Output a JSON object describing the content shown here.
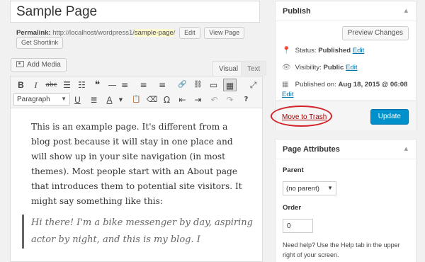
{
  "title": {
    "value": "Sample Page"
  },
  "permalink": {
    "label": "Permalink:",
    "base_url": "http://localhost/wordpress1/",
    "slug": "sample-page",
    "trailing": "/",
    "edit_label": "Edit",
    "view_label": "View Page",
    "shortlink_label": "Get Shortlink"
  },
  "media": {
    "add_label": "Add Media"
  },
  "editor_tabs": {
    "visual": "Visual",
    "text": "Text"
  },
  "toolbar": {
    "row1": [
      {
        "icon": "bold-icon",
        "glyph": "B"
      },
      {
        "icon": "italic-icon",
        "glyph": "I"
      },
      {
        "icon": "strikethrough-icon",
        "glyph": "abc"
      },
      {
        "icon": "bulleted-list-icon",
        "glyph": "☰"
      },
      {
        "icon": "numbered-list-icon",
        "glyph": "☷"
      },
      {
        "icon": "blockquote-icon",
        "glyph": "❝"
      },
      {
        "icon": "horizontal-line-icon",
        "glyph": "—"
      },
      {
        "icon": "align-left-icon",
        "glyph": "≡"
      },
      {
        "icon": "align-center-icon",
        "glyph": "≡"
      },
      {
        "icon": "align-right-icon",
        "glyph": "≡"
      },
      {
        "icon": "insert-link-icon",
        "glyph": "🔗"
      },
      {
        "icon": "remove-link-icon",
        "glyph": "⛓"
      },
      {
        "icon": "read-more-icon",
        "glyph": "▭"
      },
      {
        "icon": "toolbar-toggle-icon",
        "glyph": "▦"
      },
      {
        "icon": "fullscreen-icon",
        "glyph": "⤢"
      }
    ],
    "format_select": "Paragraph",
    "row2": [
      {
        "icon": "underline-icon",
        "glyph": "U"
      },
      {
        "icon": "justify-icon",
        "glyph": "≣"
      },
      {
        "icon": "text-color-icon",
        "glyph": "A"
      },
      {
        "icon": "paste-as-text-icon",
        "glyph": "📋"
      },
      {
        "icon": "clear-formatting-icon",
        "glyph": "⌫"
      },
      {
        "icon": "special-character-icon",
        "glyph": "Ω"
      },
      {
        "icon": "outdent-icon",
        "glyph": "⇤"
      },
      {
        "icon": "indent-icon",
        "glyph": "⇥"
      },
      {
        "icon": "undo-icon",
        "glyph": "↶"
      },
      {
        "icon": "redo-icon",
        "glyph": "↷"
      },
      {
        "icon": "help-icon",
        "glyph": "?"
      }
    ]
  },
  "content": {
    "paragraph": "This is an example page. It's different from a blog post because it will stay in one place and will show up in your site navigation (in most themes). Most people start with an About page that introduces them to potential site visitors. It might say something like this:",
    "quote": "Hi there! I'm a bike messenger by day, aspiring actor by night, and this is my blog. I"
  },
  "publish": {
    "title": "Publish",
    "preview_label": "Preview Changes",
    "status_label": "Status:",
    "status_value": "Published",
    "visibility_label": "Visibility:",
    "visibility_value": "Public",
    "published_label": "Published on:",
    "published_value": "Aug 18, 2015 @ 06:08",
    "edit_label": "Edit",
    "trash_label": "Move to Trash",
    "update_label": "Update"
  },
  "page_attributes": {
    "title": "Page Attributes",
    "parent_label": "Parent",
    "parent_value": "(no parent)",
    "order_label": "Order",
    "order_value": "0",
    "help_text": "Need help? Use the Help tab in the upper right of your screen."
  },
  "colors": {
    "link": "#0073aa",
    "primary_button": "#0091cd",
    "trash": "#a00",
    "highlight_circle": "#d2232a"
  }
}
